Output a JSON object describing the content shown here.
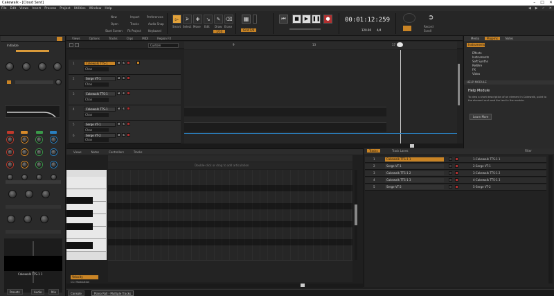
{
  "window": {
    "title": "Cakewalk - [Cloud Sent]",
    "controls": [
      "–",
      "□",
      "✕"
    ]
  },
  "menu": [
    "File",
    "Edit",
    "Views",
    "Insert",
    "Process",
    "Project",
    "Utilities",
    "Window",
    "Help"
  ],
  "menu_right": [
    "◀",
    "▶",
    "✓",
    "✕"
  ],
  "control_bar": {
    "file_buttons": [
      "New",
      "Open",
      "Start Screen",
      "Import",
      "Tracks",
      "Fit Project",
      "Preferences",
      "Audio Snap",
      "Keyboard"
    ],
    "tools": {
      "smart": "Smart",
      "select": "Select",
      "move": "Move",
      "edit": "Edit",
      "draw": "Draw",
      "erase": "Erase"
    },
    "snap_label": "1/16",
    "snap_value": "Grid  1/8",
    "time": "00:01:12:259",
    "tempo": "120.00",
    "meter": "4/4",
    "status_labels": [
      "Record",
      "Scroll"
    ]
  },
  "inspector": {
    "preset": "Initialize",
    "track_name": "Cakewalk TTS-1 1",
    "tabs": [
      "Presets",
      "Audio",
      "Mix"
    ],
    "knob_labels": [
      "Pitch",
      "Pan",
      "Gain",
      "Trim"
    ]
  },
  "track_view": {
    "header_menus": [
      "Views",
      "Options",
      "Tracks",
      "Clips",
      "MIDI",
      "Region FX"
    ],
    "snap_field": "Custom",
    "ruler": [
      "9",
      "13",
      "17"
    ],
    "tracks": [
      {
        "num": "1",
        "name": "Cakewalk TTS-1",
        "sub": "Chan",
        "highlight": true
      },
      {
        "num": "2",
        "name": "Serge VT-1",
        "sub": "Chan",
        "highlight": false
      },
      {
        "num": "3",
        "name": "Cakewalk TTS-1",
        "sub": "Chan",
        "highlight": false
      },
      {
        "num": "4",
        "name": "Cakewalk TTS-1",
        "sub": "Chan",
        "highlight": false
      },
      {
        "num": "5",
        "name": "Serge VT-1",
        "sub": "Chan",
        "highlight": false
      },
      {
        "num": "6",
        "name": "Serge VT-2",
        "sub": "Chan",
        "highlight": false
      }
    ]
  },
  "browser": {
    "tabs": [
      "Media",
      "Plug-ins",
      "Notes"
    ],
    "filter": "Instruments",
    "items": [
      "Effects",
      "Instruments",
      "Soft Synths",
      "ReWire",
      "FX",
      "Video"
    ],
    "help_title": "HELP MODULE",
    "help_heading": "Help Module",
    "help_text": "To view a short description of an element in Cakewalk, point to the element and read the text in the module.",
    "help_button": "Learn More"
  },
  "piano_roll": {
    "header_menus": [
      "Views",
      "Notes",
      "Controllers",
      "Tracks"
    ],
    "hint": "Double-click or drag to add articulation",
    "velocity_label": "Velocity",
    "ctrl_label": "CC: Modulation"
  },
  "track_pane": {
    "tabs": [
      "Tracks",
      "Track Lanes"
    ],
    "filter_label": "Filter",
    "rows": [
      {
        "num": "1",
        "name": "Cakewalk TTS-1 1",
        "out": "1-Cakewalk TTS-1 1",
        "selected": true
      },
      {
        "num": "2",
        "name": "Serge VT-1",
        "out": "2-Serge VT-1",
        "selected": false
      },
      {
        "num": "3",
        "name": "Cakewalk TTS-1 2",
        "out": "3-Cakewalk TTS-1 2",
        "selected": false
      },
      {
        "num": "4",
        "name": "Cakewalk TTS-1 3",
        "out": "4-Cakewalk TTS-1 3",
        "selected": false
      },
      {
        "num": "5",
        "name": "Serge VT-2",
        "out": "5-Serge VT-2",
        "selected": false
      }
    ]
  },
  "bottom_tabs": [
    "Console",
    "Piano Roll - Multiple Tracks"
  ],
  "colors": {
    "accent": "#c98425",
    "record": "#b03030",
    "bg": "#1e1e1e"
  }
}
